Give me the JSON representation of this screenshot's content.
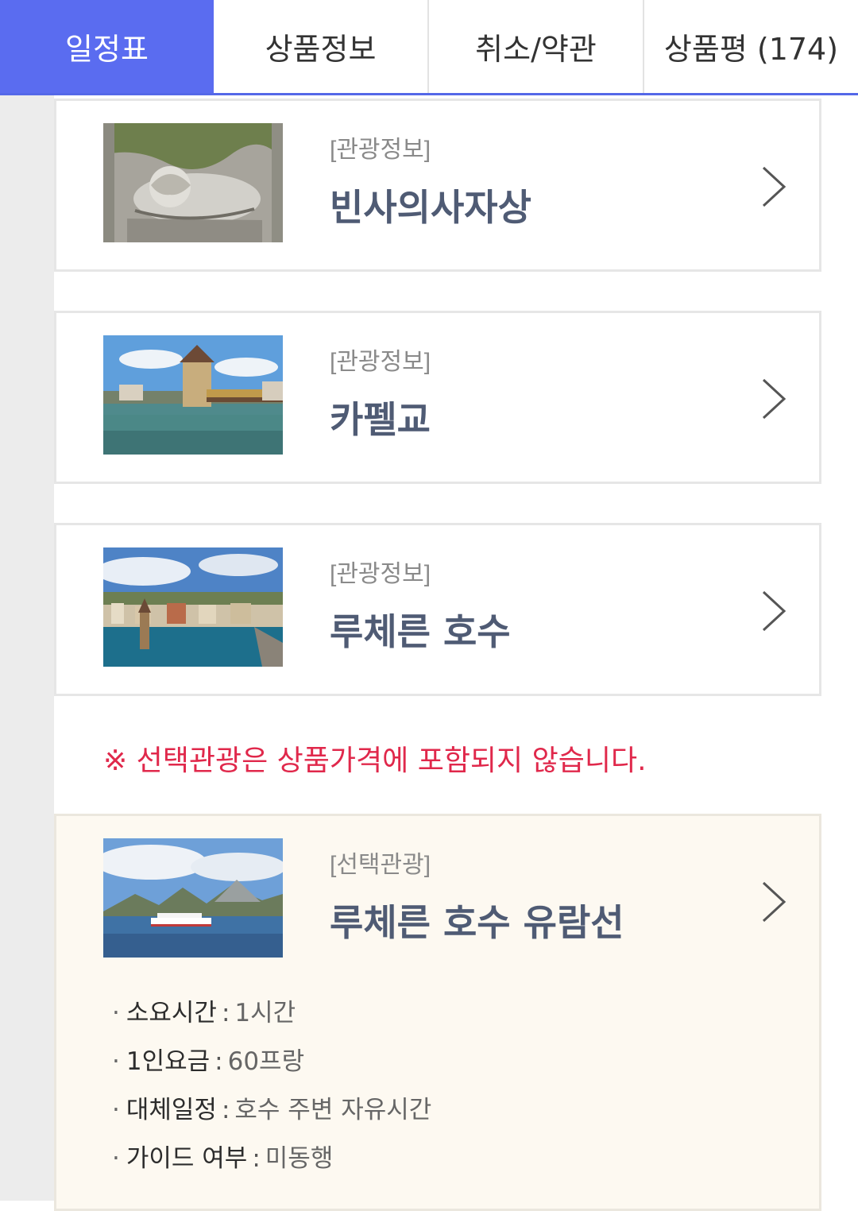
{
  "tabs": [
    {
      "label": "일정표",
      "active": true
    },
    {
      "label": "상품정보",
      "active": false
    },
    {
      "label": "취소/약관",
      "active": false
    },
    {
      "label": "상품평 (174)",
      "active": false
    }
  ],
  "colors": {
    "tab_active": "#5a6cf0",
    "title_text": "#4f5b74",
    "notice_text": "#e0284b",
    "optional_card_bg": "#fdf9f1"
  },
  "attractions": [
    {
      "category": "[관광정보]",
      "name": "빈사의사자상",
      "image": "lion-monument-photo"
    },
    {
      "category": "[관광정보]",
      "name": "카펠교",
      "image": "chapel-bridge-photo"
    },
    {
      "category": "[관광정보]",
      "name": "루체른 호수",
      "image": "lake-lucerne-photo"
    }
  ],
  "notice": "※ 선택관광은 상품가격에 포함되지 않습니다.",
  "optional_tour": {
    "category": "[선택관광]",
    "name": "루체른 호수 유람선",
    "image": "lake-cruise-photo",
    "details": [
      {
        "key": "소요시간",
        "value": "1시간"
      },
      {
        "key": "1인요금",
        "value": "60프랑"
      },
      {
        "key": "대체일정",
        "value": "호수 주변 자유시간"
      },
      {
        "key": "가이드 여부",
        "value": "미동행"
      }
    ]
  }
}
